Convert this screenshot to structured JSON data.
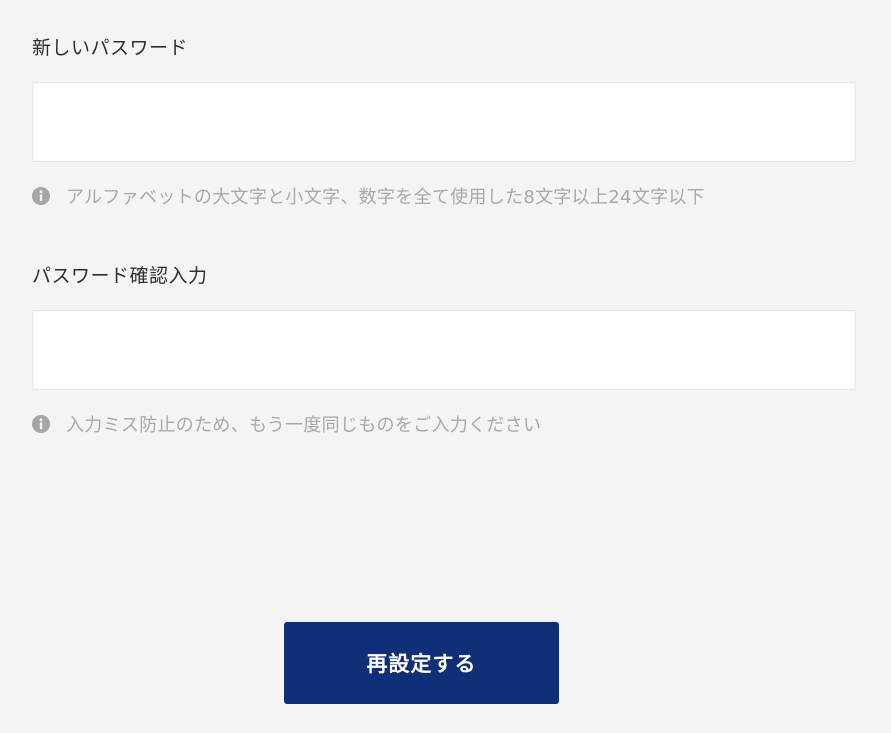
{
  "new_password": {
    "label": "新しいパスワード",
    "value": "",
    "hint": "アルファベットの大文字と小文字、数字を全て使用した8文字以上24文字以下",
    "hint_icon": "info-circle-icon"
  },
  "confirm_password": {
    "label": "パスワード確認入力",
    "value": "",
    "hint": "入力ミス防止のため、もう一度同じものをご入力ください",
    "hint_icon": "info-circle-icon"
  },
  "submit": {
    "label": "再設定する"
  },
  "colors": {
    "background": "#f4f4f4",
    "button": "#0f2f78",
    "hint_text": "#a9a9a9",
    "icon": "#a6a6a6"
  }
}
